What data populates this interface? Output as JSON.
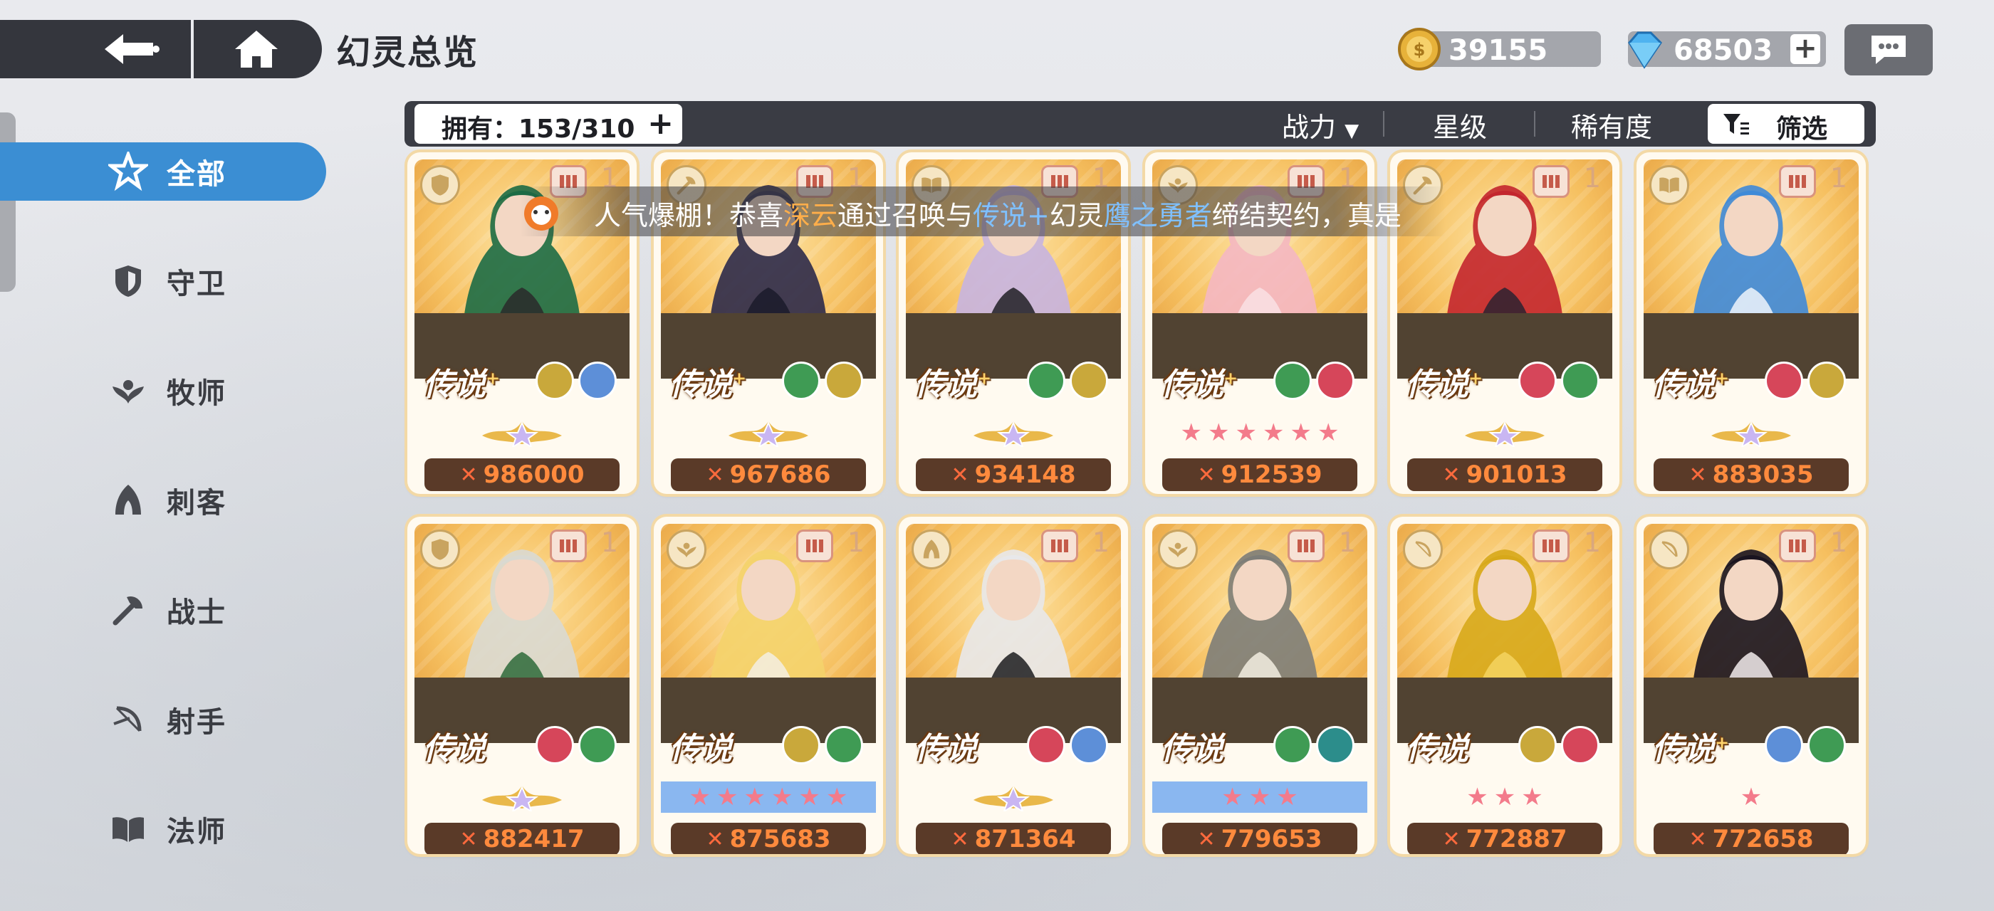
{
  "header": {
    "title": "幻灵总览",
    "gold": "39155",
    "gems": "68503",
    "plus_label": "+"
  },
  "sidebar": {
    "items": [
      {
        "label": "全部",
        "icon": "all-star-icon",
        "active": true
      },
      {
        "label": "守卫",
        "icon": "shield-icon"
      },
      {
        "label": "牧师",
        "icon": "leaf-wings-icon"
      },
      {
        "label": "刺客",
        "icon": "hood-icon"
      },
      {
        "label": "战士",
        "icon": "axe-icon"
      },
      {
        "label": "射手",
        "icon": "bow-icon"
      },
      {
        "label": "法师",
        "icon": "book-icon"
      }
    ]
  },
  "filterbar": {
    "owned": "拥有：153/310",
    "sort_power": "战力",
    "sort_stars": "星级",
    "sort_rarity": "稀有度",
    "filter": "筛选"
  },
  "marquee": {
    "pre": "人气爆棚！恭喜",
    "player": "深云",
    "mid": "通过召唤与",
    "rarity": "传说+",
    "mid2": "幻灵",
    "hero": "鹰之勇者",
    "post": "缔结契约，真是"
  },
  "cards": [
    {
      "power": "986000",
      "rarity": "传说",
      "plus": true,
      "level": "1",
      "class_icon": "shield-icon",
      "elements": [
        "wind",
        "ice"
      ],
      "stars": "crown",
      "colors": [
        "#1c6b45",
        "#2a2a2a"
      ]
    },
    {
      "power": "967686",
      "rarity": "传说",
      "plus": true,
      "level": "1",
      "class_icon": "axe-icon",
      "elements": [
        "nature",
        "wind"
      ],
      "stars": "crown",
      "colors": [
        "#2c2a4a",
        "#1b1b2a"
      ]
    },
    {
      "power": "934148",
      "rarity": "传说",
      "plus": true,
      "level": "1",
      "class_icon": "book-icon",
      "elements": [
        "nature",
        "wind"
      ],
      "stars": "crown",
      "colors": [
        "#c6b4e0",
        "#202024"
      ]
    },
    {
      "power": "912539",
      "rarity": "传说",
      "plus": true,
      "level": "1",
      "class_icon": "leaf-wings-icon",
      "elements": [
        "nature",
        "fire"
      ],
      "stars": "6",
      "colors": [
        "#f4b7c2",
        "#f9e0e4"
      ]
    },
    {
      "power": "901013",
      "rarity": "传说",
      "plus": true,
      "level": "1",
      "class_icon": "axe-icon",
      "elements": [
        "fire",
        "nature"
      ],
      "stars": "crown",
      "colors": [
        "#c3262e",
        "#2b2230"
      ]
    },
    {
      "power": "883035",
      "rarity": "传说",
      "plus": true,
      "level": "1",
      "class_icon": "book-icon",
      "elements": [
        "fire",
        "wind"
      ],
      "stars": "crown",
      "colors": [
        "#3f8ad8",
        "#eef4fb"
      ]
    },
    {
      "power": "882417",
      "rarity": "传说",
      "plus": false,
      "level": "1",
      "class_icon": "shield-icon",
      "elements": [
        "fire",
        "nature"
      ],
      "stars": "crown",
      "colors": [
        "#d9d9d2",
        "#2e6a3a"
      ]
    },
    {
      "power": "875683",
      "rarity": "传说",
      "plus": false,
      "level": "1",
      "class_icon": "leaf-wings-icon",
      "elements": [
        "wind",
        "nature"
      ],
      "stars": "6-blue",
      "colors": [
        "#f4d36c",
        "#f3efe3"
      ]
    },
    {
      "power": "871364",
      "rarity": "传说",
      "plus": false,
      "level": "1",
      "class_icon": "hood-icon",
      "elements": [
        "fire",
        "ice"
      ],
      "stars": "crown",
      "colors": [
        "#e8e8ea",
        "#1c1c1f"
      ]
    },
    {
      "power": "779653",
      "rarity": "传说",
      "plus": false,
      "level": "1",
      "class_icon": "leaf-wings-icon",
      "elements": [
        "nature",
        "dark"
      ],
      "stars": "3-blue",
      "colors": [
        "#7d7d78",
        "#f2ede0"
      ]
    },
    {
      "power": "772887",
      "rarity": "传说",
      "plus": false,
      "level": "1",
      "class_icon": "bow-icon",
      "elements": [
        "wind",
        "fire"
      ],
      "stars": "3",
      "colors": [
        "#d7a81a",
        "#f5d460"
      ]
    },
    {
      "power": "772658",
      "rarity": "传说",
      "plus": true,
      "level": "1",
      "class_icon": "bow-icon",
      "elements": [
        "ice",
        "nature"
      ],
      "stars": "1",
      "colors": [
        "#1a1420",
        "#f2ecec"
      ]
    }
  ]
}
